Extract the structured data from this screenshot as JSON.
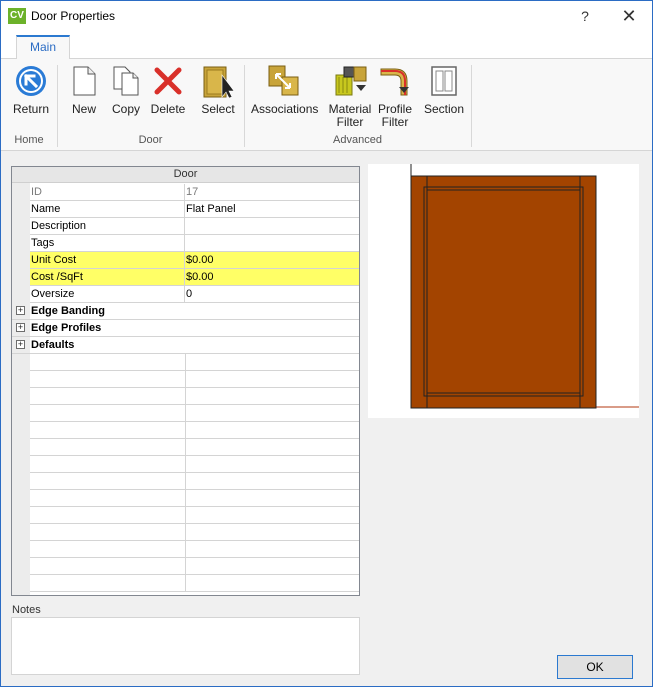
{
  "window": {
    "app_icon_text": "CV",
    "title": "Door Properties",
    "help_glyph": "?",
    "close_glyph": "✕"
  },
  "ribbon": {
    "tabs": [
      {
        "label": "Main",
        "active": true
      }
    ],
    "buttons": {
      "return": "Return",
      "new": "New",
      "copy": "Copy",
      "delete": "Delete",
      "select": "Select",
      "associations": "Associations",
      "material_filter_1": "Material",
      "material_filter_2": "Filter",
      "profile_filter_1": "Profile",
      "profile_filter_2": "Filter",
      "section": "Section"
    },
    "groups": {
      "home": "Home",
      "door": "Door",
      "advanced": "Advanced"
    }
  },
  "grid": {
    "header": "Door",
    "rows": [
      {
        "name": "ID",
        "value": "17",
        "readonly": true,
        "highlight": false
      },
      {
        "name": "Name",
        "value": "Flat Panel",
        "readonly": false,
        "highlight": false
      },
      {
        "name": "Description",
        "value": "",
        "readonly": false,
        "highlight": false
      },
      {
        "name": "Tags",
        "value": "",
        "readonly": false,
        "highlight": false
      },
      {
        "name": "Unit Cost",
        "value": "$0.00",
        "readonly": false,
        "highlight": true
      },
      {
        "name": "Cost /SqFt",
        "value": "$0.00",
        "readonly": false,
        "highlight": true
      },
      {
        "name": "Oversize",
        "value": "0",
        "readonly": false,
        "highlight": false
      }
    ],
    "categories": [
      {
        "label": "Edge Banding",
        "expander": "+"
      },
      {
        "label": "Edge Profiles",
        "expander": "+"
      },
      {
        "label": "Defaults",
        "expander": "+"
      }
    ]
  },
  "notes": {
    "label": "Notes",
    "value": ""
  },
  "colors": {
    "door_frame": "#a34400",
    "door_panel": "#a34400",
    "highlight": "#ffff66",
    "accent": "#2b79d0"
  },
  "footer": {
    "ok_label": "OK"
  }
}
